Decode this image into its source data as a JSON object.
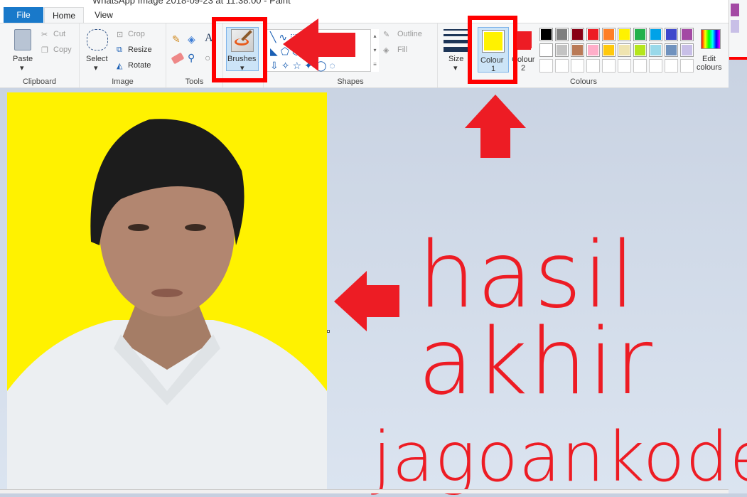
{
  "window": {
    "title": "WhatsApp Image 2018-09-23 at 11.38.00 - Paint"
  },
  "tabs": [
    {
      "label": "File"
    },
    {
      "label": "Home"
    },
    {
      "label": "View"
    }
  ],
  "clipboard": {
    "paste": "Paste",
    "cut": "Cut",
    "copy": "Copy",
    "label": "Clipboard"
  },
  "image": {
    "select": "Select",
    "crop": "Crop",
    "resize": "Resize",
    "rotate": "Rotate",
    "label": "Image"
  },
  "tools": {
    "label": "Tools"
  },
  "brushes": {
    "label": "Brushes"
  },
  "shapes": {
    "outline": "Outline",
    "fill": "Fill",
    "label": "Shapes"
  },
  "size": {
    "label": "Size"
  },
  "colours": {
    "colour1": "Colour",
    "colour1_num": "1",
    "colour2": "Colour",
    "colour2_num": "2",
    "edit": "Edit",
    "edit2": "colours",
    "label": "Colours",
    "colour1_value": "#fff200",
    "colour2_value": "#ed1c24",
    "palette_row1": [
      "#000000",
      "#7f7f7f",
      "#880015",
      "#ed1c24",
      "#ff7f27",
      "#fff200",
      "#22b14c",
      "#00a2e8",
      "#3f48cc",
      "#a349a4"
    ],
    "palette_row2": [
      "#ffffff",
      "#c3c3c3",
      "#b97a57",
      "#ffaec9",
      "#ffc90e",
      "#efe4b0",
      "#b5e61d",
      "#99d9ea",
      "#7092be",
      "#c8bfe7"
    ]
  },
  "overlay": {
    "line1": "hasil",
    "line2": "akhir",
    "line3": "jagoankode",
    "accent": "#ed1c24"
  }
}
